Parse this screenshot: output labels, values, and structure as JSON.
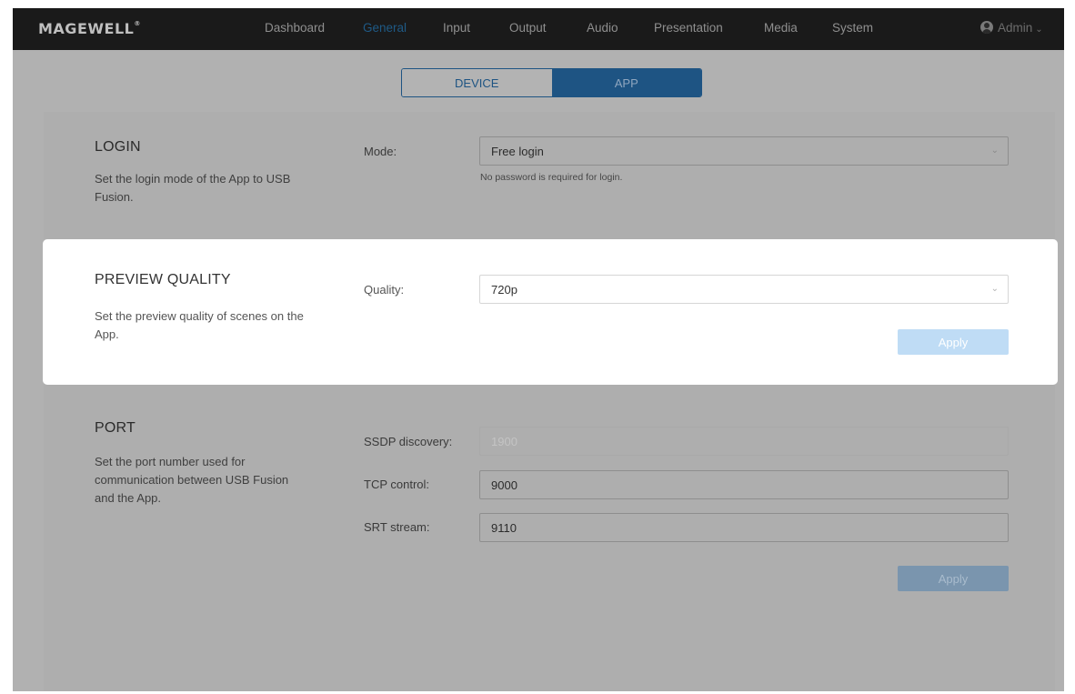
{
  "brand": "MAGEWELL",
  "nav": {
    "items": [
      {
        "label": "Dashboard",
        "active": false
      },
      {
        "label": "General",
        "active": true
      },
      {
        "label": "Input",
        "active": false
      },
      {
        "label": "Output",
        "active": false
      },
      {
        "label": "Audio",
        "active": false
      },
      {
        "label": "Presentation",
        "active": false
      },
      {
        "label": "Media",
        "active": false
      },
      {
        "label": "System",
        "active": false
      }
    ],
    "user": "Admin"
  },
  "tabs": {
    "device": "DEVICE",
    "app": "APP",
    "selected": "APP"
  },
  "login": {
    "title": "LOGIN",
    "description": "Set the login mode of the App to USB Fusion.",
    "mode_label": "Mode:",
    "mode_value": "Free login",
    "hint": "No password is required for login."
  },
  "preview": {
    "title": "PREVIEW QUALITY",
    "description": "Set the preview quality of scenes on the App.",
    "quality_label": "Quality:",
    "quality_value": "720p",
    "apply_label": "Apply"
  },
  "port": {
    "title": "PORT",
    "description": "Set the port number used for communication between USB Fusion and the App.",
    "ssdp_label": "SSDP discovery:",
    "ssdp_value": "1900",
    "tcp_label": "TCP control:",
    "tcp_value": "9000",
    "srt_label": "SRT stream:",
    "srt_value": "9110",
    "apply_label": "Apply"
  },
  "colors": {
    "accent": "#1e5483",
    "apply_disabled": "#bfdcf5",
    "overlay": "#aeaeae"
  }
}
